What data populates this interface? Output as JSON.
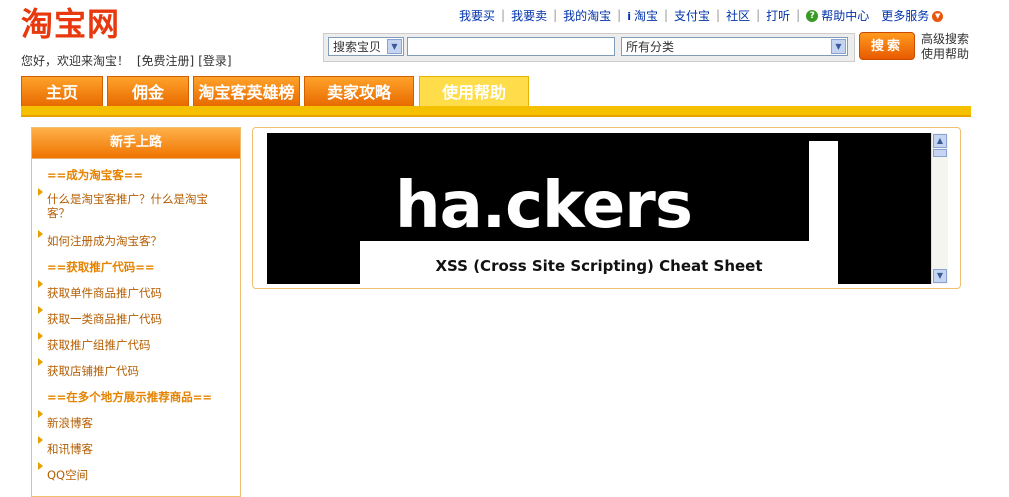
{
  "header": {
    "logo": "淘宝网",
    "welcome": "您好，欢迎来淘宝！",
    "register": "[免费注册]",
    "login": "[登录]"
  },
  "toplinks": [
    {
      "label": "我要买"
    },
    {
      "label": "我要卖"
    },
    {
      "label": "我的淘宝"
    },
    {
      "label": "淘宝"
    },
    {
      "label": "支付宝"
    },
    {
      "label": "社区"
    },
    {
      "label": "打听"
    },
    {
      "label": "帮助中心"
    },
    {
      "label": "更多服务"
    }
  ],
  "search": {
    "type_selected": "搜索宝贝",
    "query": "",
    "category_selected": "所有分类",
    "button": "搜索",
    "advanced": "高级搜索",
    "help": "使用帮助"
  },
  "nav": {
    "tabs": [
      {
        "label": "主页"
      },
      {
        "label": "佣金"
      },
      {
        "label": "淘宝客英雄榜"
      },
      {
        "label": "卖家攻略"
      },
      {
        "label": "使用帮助"
      }
    ]
  },
  "sidebar": {
    "title": "新手上路",
    "items": [
      {
        "label": "==成为淘宝客==",
        "kind": "section"
      },
      {
        "label": "什么是淘宝客推广？什么是淘宝客？",
        "kind": "link"
      },
      {
        "label": "如何注册成为淘宝客？",
        "kind": "link"
      },
      {
        "label": "==获取推广代码==",
        "kind": "section"
      },
      {
        "label": "获取单件商品推广代码",
        "kind": "link"
      },
      {
        "label": "获取一类商品推广代码",
        "kind": "link"
      },
      {
        "label": "获取推广组推广代码",
        "kind": "link"
      },
      {
        "label": "获取店铺推广代码",
        "kind": "link"
      },
      {
        "label": "==在多个地方展示推荐商品==",
        "kind": "section"
      },
      {
        "label": "新浪博客",
        "kind": "link"
      },
      {
        "label": "和讯博客",
        "kind": "link"
      },
      {
        "label": "QQ空间",
        "kind": "link"
      }
    ]
  },
  "banner": {
    "logo_text": "ha.ckers",
    "subtitle": "XSS (Cross Site Scripting) Cheat Sheet"
  },
  "colors": {
    "brand": "#e8380d",
    "tab_orange": "#f08000",
    "tab_active": "#ffdc49",
    "nav_bar": "#f5c000"
  }
}
